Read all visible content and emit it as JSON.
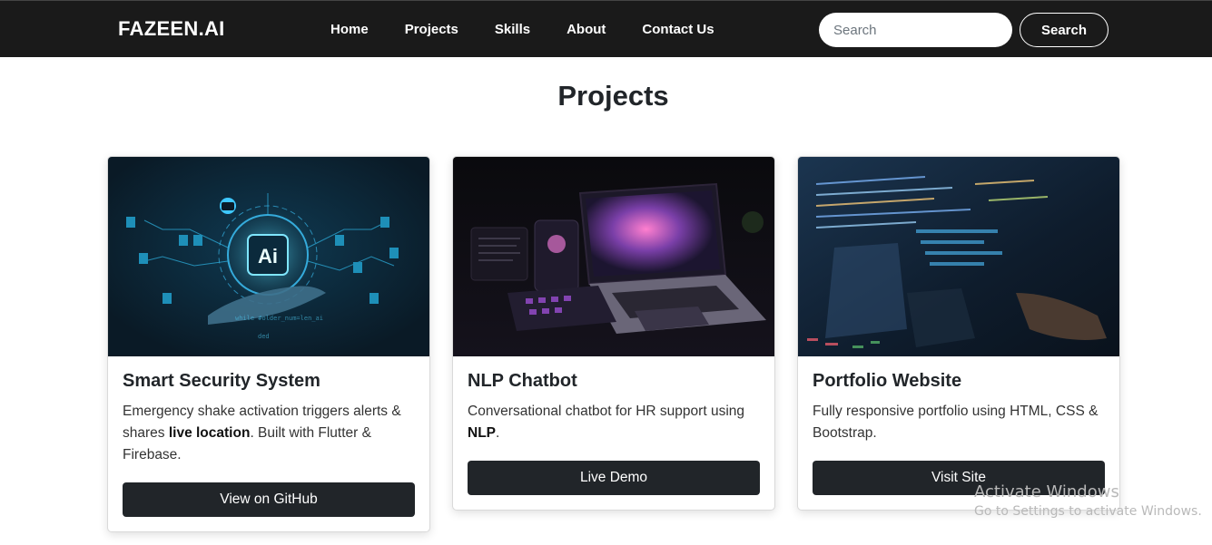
{
  "navbar": {
    "brand": "FAZEEN.AI",
    "links": [
      "Home",
      "Projects",
      "Skills",
      "About",
      "Contact Us"
    ],
    "search_placeholder": "Search",
    "search_button": "Search"
  },
  "page": {
    "title": "Projects"
  },
  "cards": [
    {
      "title": "Smart Security System",
      "text_1": "Emergency shake activation triggers alerts & shares ",
      "text_bold": "live location",
      "text_2": ". Built with Flutter & Firebase.",
      "button": "View on GitHub",
      "image": "ai-hand-circuit-illustration",
      "image_text": "Ai"
    },
    {
      "title": "NLP Chatbot",
      "text_1": "Conversational chatbot for HR support using ",
      "text_bold": "NLP",
      "text_2": ".",
      "button": "Live Demo",
      "image": "laptop-and-devices-dark-desk"
    },
    {
      "title": "Portfolio Website",
      "text_1": "Fully responsive portfolio using HTML, CSS & Bootstrap.",
      "text_bold": "",
      "text_2": "",
      "button": "Visit Site",
      "image": "code-screen-typing-hands"
    }
  ],
  "watermark": {
    "line1": "Activate Windows",
    "line2": "Go to Settings to activate Windows."
  },
  "colors": {
    "navbar": "#1a1a1a",
    "button": "#212529",
    "accent_cyan": "#3ec8ff"
  }
}
